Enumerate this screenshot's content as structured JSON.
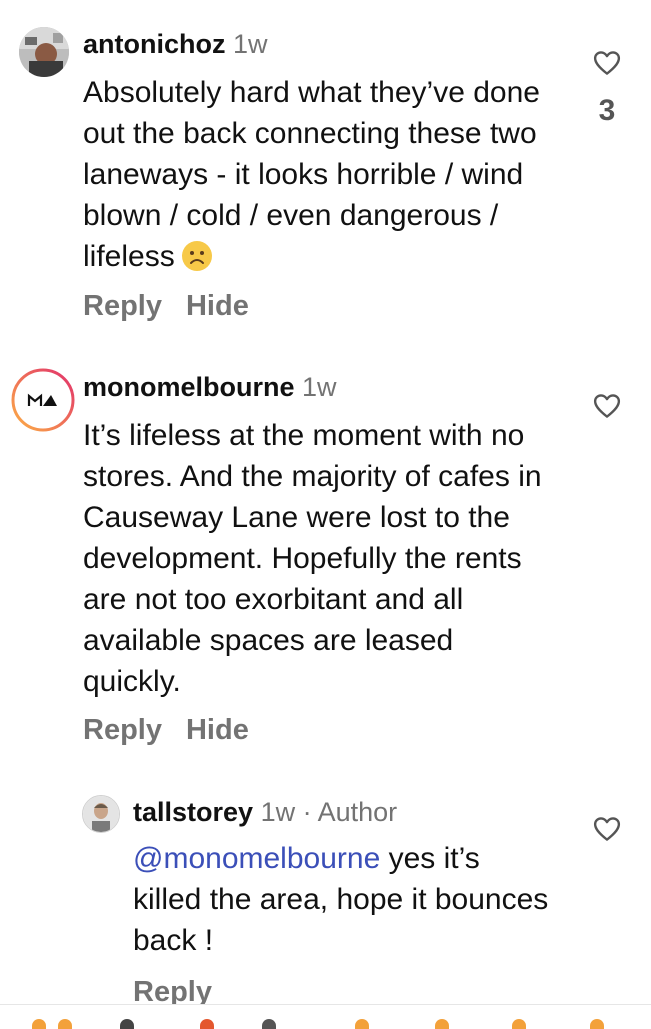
{
  "comments": [
    {
      "username": "antonichoz",
      "time": "1w",
      "text": "Absolutely hard what they’ve done out the back connecting these two laneways - it looks horrible / wind blown / cold / even dangerous / lifeless",
      "emoji": "sad-face",
      "like_count": "3",
      "reply_label": "Reply",
      "hide_label": "Hide"
    },
    {
      "username": "monomelbourne",
      "time": "1w",
      "text": "It’s lifeless at the moment with no stores. And the majority of cafes in Causeway Lane were lost to the development. Hopefully the rents are not too exorbitant and all available spaces are leased quickly.",
      "reply_label": "Reply",
      "hide_label": "Hide"
    }
  ],
  "reply": {
    "username": "tallstorey",
    "time": "1w",
    "author_tag": "· Author",
    "mention": "@monomelbourne",
    "text": " yes it’s killed the area, hope it bounces back !",
    "reply_label": "Reply"
  },
  "colors": {
    "secondary_text": "#737373",
    "mention": "#3b4fb8",
    "story_ring_start": "#fcaf45",
    "story_ring_end": "#e1306c"
  },
  "icons": {
    "like": "heart-outline-icon",
    "emoji": "sad-face-emoji-icon"
  }
}
